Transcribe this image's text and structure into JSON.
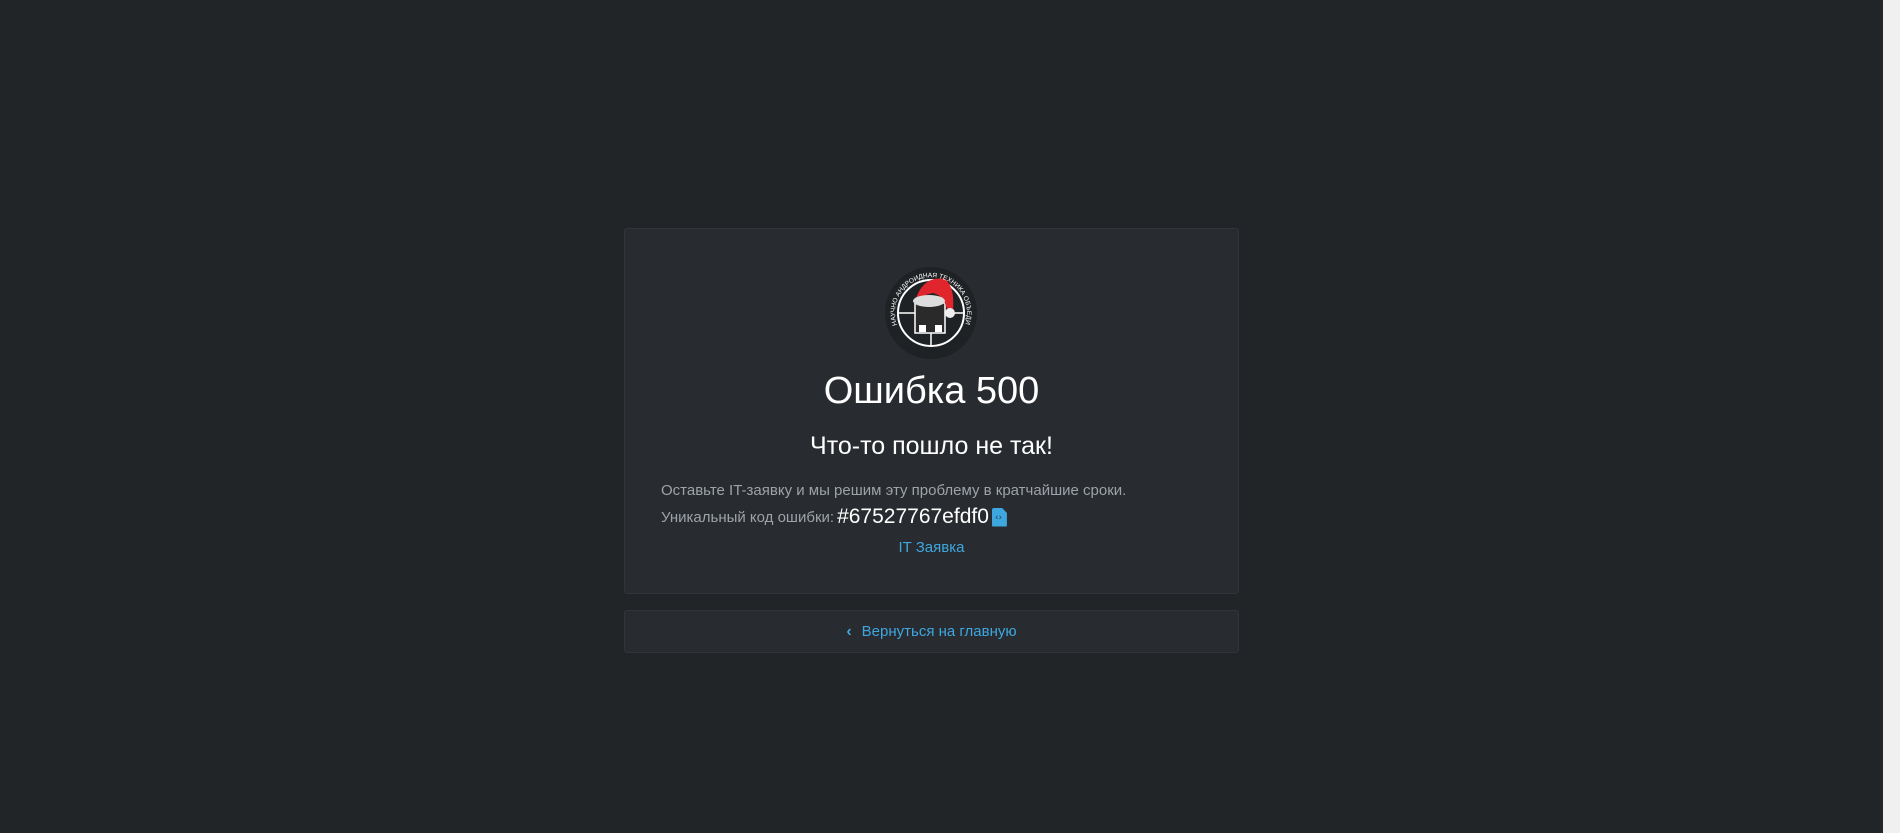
{
  "error": {
    "title": "Ошибка 500",
    "subtitle": "Что-то пошло не так!",
    "message": "Оставьте IT-заявку и мы решим эту проблему в кратчайшие сроки.",
    "code_label": "Уникальный код ошибки:",
    "code_value": "#67527767efdf0",
    "it_request_link": "IT Заявка"
  },
  "logo": {
    "text": "НАУЧНО АНДРОИДНАЯ ТЕХНИКА ПРОИЗВОДСТВЕННОЕ ОБЪЕДИНЕНИЕ"
  },
  "back_button": {
    "label": "Вернуться на главную"
  },
  "colors": {
    "accent": "#3ea7e0",
    "background": "#222528",
    "card": "#282b2f"
  }
}
